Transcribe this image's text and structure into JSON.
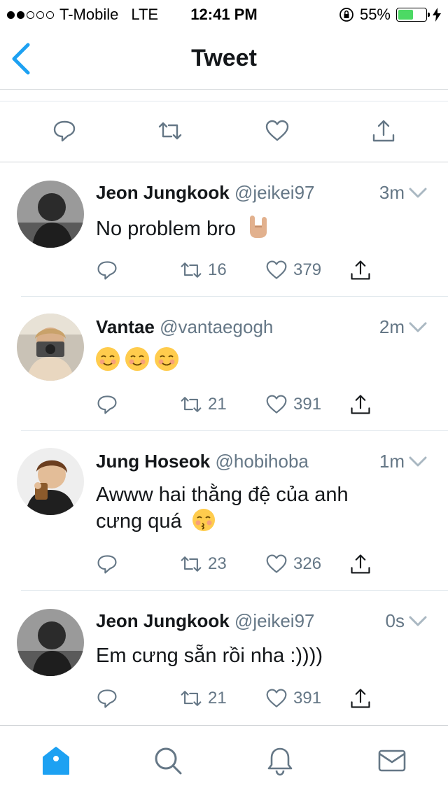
{
  "status_bar": {
    "carrier": "T-Mobile",
    "network": "LTE",
    "time": "12:41 PM",
    "battery": "55%",
    "battery_level": 0.55
  },
  "nav": {
    "title": "Tweet",
    "back_icon": "chevron-left-icon"
  },
  "colors": {
    "accent": "#1da1f2",
    "secondary_text": "#657786",
    "icon_gray": "#657786",
    "battery_green": "#4cd964"
  },
  "replies": [
    {
      "name": "Jeon Jungkook",
      "handle": "@jeikei97",
      "time": "3m",
      "text": "No problem bro",
      "retweets": "16",
      "likes": "379"
    },
    {
      "name": "Vantae",
      "handle": "@vantaegogh",
      "time": "2m",
      "text": "",
      "retweets": "21",
      "likes": "391"
    },
    {
      "name": "Jung Hoseok",
      "handle": "@hobihoba",
      "time": "1m",
      "text_line1": "Awww hai thằng đệ của anh",
      "text_line2": "cưng quá",
      "retweets": "23",
      "likes": "326"
    },
    {
      "name": "Jeon Jungkook",
      "handle": "@jeikei97",
      "time": "0s",
      "text": "Em cưng sẵn rồi nha :))))",
      "retweets": "21",
      "likes": "391"
    }
  ],
  "tab_bar": {
    "items": [
      "home-icon",
      "search-icon",
      "notifications-icon",
      "messages-icon"
    ],
    "active": "home-icon"
  }
}
